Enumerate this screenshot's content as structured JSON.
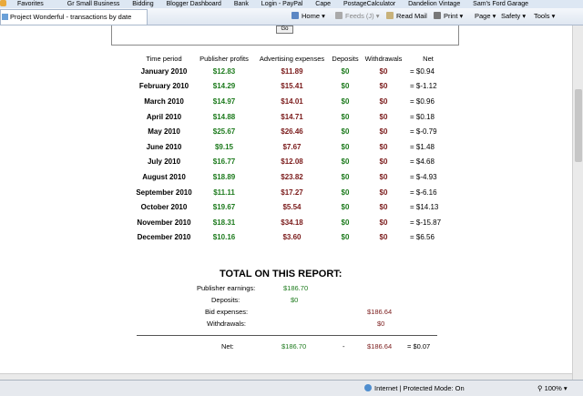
{
  "favorites_bar": {
    "items": [
      "Favorites",
      "Gr Small Business",
      "Bidding",
      "Blogger Dashboard",
      "Bank",
      "Login - PayPal",
      "Cape",
      "PostageCalculator",
      "Dandelion Vintage",
      "Sam's Ford Garage"
    ]
  },
  "browser": {
    "tab_title": "Project Wonderful - transactions by date",
    "commands": {
      "home": "Home",
      "feeds": "Feeds (J)",
      "read_mail": "Read Mail",
      "print": "Print",
      "page": "Page",
      "safety": "Safety",
      "tools": "Tools"
    }
  },
  "form": {
    "go_label": "Go"
  },
  "table": {
    "headers": [
      "Time period",
      "Publisher profits",
      "Advertising expenses",
      "Deposits",
      "Withdrawals",
      "Net"
    ],
    "rows": [
      {
        "period": "January 2010",
        "profits": "$12.83",
        "expenses": "$11.89",
        "deposits": "$0",
        "withdrawals": "$0",
        "net": "= $0.94"
      },
      {
        "period": "February 2010",
        "profits": "$14.29",
        "expenses": "$15.41",
        "deposits": "$0",
        "withdrawals": "$0",
        "net": "= $-1.12"
      },
      {
        "period": "March 2010",
        "profits": "$14.97",
        "expenses": "$14.01",
        "deposits": "$0",
        "withdrawals": "$0",
        "net": "= $0.96"
      },
      {
        "period": "April 2010",
        "profits": "$14.88",
        "expenses": "$14.71",
        "deposits": "$0",
        "withdrawals": "$0",
        "net": "= $0.18"
      },
      {
        "period": "May 2010",
        "profits": "$25.67",
        "expenses": "$26.46",
        "deposits": "$0",
        "withdrawals": "$0",
        "net": "= $-0.79"
      },
      {
        "period": "June 2010",
        "profits": "$9.15",
        "expenses": "$7.67",
        "deposits": "$0",
        "withdrawals": "$0",
        "net": "= $1.48"
      },
      {
        "period": "July 2010",
        "profits": "$16.77",
        "expenses": "$12.08",
        "deposits": "$0",
        "withdrawals": "$0",
        "net": "= $4.68"
      },
      {
        "period": "August 2010",
        "profits": "$18.89",
        "expenses": "$23.82",
        "deposits": "$0",
        "withdrawals": "$0",
        "net": "= $-4.93"
      },
      {
        "period": "September 2010",
        "profits": "$11.11",
        "expenses": "$17.27",
        "deposits": "$0",
        "withdrawals": "$0",
        "net": "= $-6.16"
      },
      {
        "period": "October 2010",
        "profits": "$19.67",
        "expenses": "$5.54",
        "deposits": "$0",
        "withdrawals": "$0",
        "net": "= $14.13"
      },
      {
        "period": "November 2010",
        "profits": "$18.31",
        "expenses": "$34.18",
        "deposits": "$0",
        "withdrawals": "$0",
        "net": "= $-15.87"
      },
      {
        "period": "December 2010",
        "profits": "$10.16",
        "expenses": "$3.60",
        "deposits": "$0",
        "withdrawals": "$0",
        "net": "= $6.56"
      }
    ]
  },
  "summary": {
    "title": "TOTAL ON THIS REPORT:",
    "publisher_earnings_label": "Publisher earnings:",
    "publisher_earnings_value": "$186.70",
    "deposits_label": "Deposits:",
    "deposits_value": "$0",
    "bid_expenses_label": "Bid expenses:",
    "bid_expenses_value": "$186.64",
    "withdrawals_label": "Withdrawals:",
    "withdrawals_value": "$0",
    "net_label": "Net:",
    "net_earnings": "$186.70",
    "net_minus": "-",
    "net_expenses": "$186.64",
    "net_value": "= $0.07"
  },
  "statusbar": {
    "zone": "Internet | Protected Mode: On",
    "zoom": "100%"
  }
}
